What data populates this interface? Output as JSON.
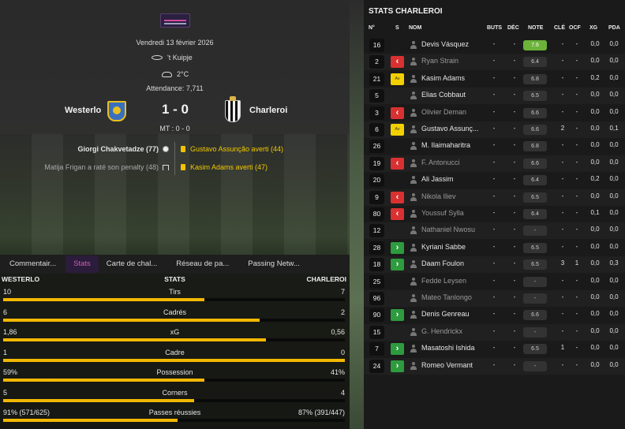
{
  "match": {
    "date": "Vendredi 13 février 2026",
    "venue": "'t Kuipje",
    "weather": "2°C",
    "attendance": "Attendance: 7,711",
    "home": "Westerlo",
    "away": "Charleroi",
    "score": "1 - 0",
    "ht": "MT : 0 - 0"
  },
  "events": {
    "home": [
      {
        "text": "Giorgi Chakvetadze (77)",
        "icon": "ball-icon"
      },
      {
        "text": "Matija Frigan a raté son penalty (48)",
        "icon": "goal-icon"
      }
    ],
    "away": [
      {
        "text": "Gustavo Assunção averti (44)",
        "icon": "yellow-card-icon"
      },
      {
        "text": "Kasim Adams averti (47)",
        "icon": "yellow-card-icon"
      }
    ]
  },
  "tabs": [
    "Commentair...",
    "Stats",
    "Carte de chal...",
    "Réseau de pa...",
    "Passing Netw..."
  ],
  "active_tab": "Stats",
  "stats": {
    "home_label": "WESTERLO",
    "title": "STATS",
    "away_label": "CHARLEROI",
    "rows": [
      {
        "name": "Tirs",
        "home": "10",
        "away": "7",
        "share": 0.59
      },
      {
        "name": "Cadrés",
        "home": "6",
        "away": "2",
        "share": 0.75
      },
      {
        "name": "xG",
        "home": "1,86",
        "away": "0,56",
        "share": 0.77
      },
      {
        "name": "Cadre",
        "home": "1",
        "away": "0",
        "share": 1.0
      },
      {
        "name": "Possession",
        "home": "59%",
        "away": "41%",
        "share": 0.59
      },
      {
        "name": "Corners",
        "home": "5",
        "away": "4",
        "share": 0.56
      },
      {
        "name": "Passes réussies",
        "home": "91% (571/625)",
        "away": "87% (391/447)",
        "share": 0.51
      }
    ]
  },
  "team_stats": {
    "title": "STATS CHARLEROI",
    "headers": [
      "N°",
      "S",
      "NOM",
      "BUTS",
      "DÉC",
      "NOTE",
      "CLÉ",
      "OCF",
      "XG",
      "PDA"
    ],
    "players": [
      {
        "num": "16",
        "status": "",
        "name": "Devis Vásquez",
        "dim": false,
        "buts": "-",
        "dec": "-",
        "note": "7.6",
        "best": true,
        "cle": "-",
        "ocf": "-",
        "xg": "0,0",
        "pda": "0,0"
      },
      {
        "num": "2",
        "status": "off",
        "name": "Ryan Strain",
        "dim": true,
        "buts": "-",
        "dec": "-",
        "note": "6.4",
        "best": false,
        "cle": "-",
        "ocf": "-",
        "xg": "0,0",
        "pda": "0,0"
      },
      {
        "num": "21",
        "status": "yellow",
        "name": "Kasim Adams",
        "dim": false,
        "buts": "-",
        "dec": "-",
        "note": "6.8",
        "best": false,
        "cle": "-",
        "ocf": "-",
        "xg": "0,2",
        "pda": "0,0"
      },
      {
        "num": "5",
        "status": "",
        "name": "Elias Cobbaut",
        "dim": false,
        "buts": "-",
        "dec": "-",
        "note": "6.5",
        "best": false,
        "cle": "-",
        "ocf": "-",
        "xg": "0,0",
        "pda": "0,0"
      },
      {
        "num": "3",
        "status": "off",
        "name": "Olivier Deman",
        "dim": true,
        "buts": "-",
        "dec": "-",
        "note": "6.6",
        "best": false,
        "cle": "-",
        "ocf": "-",
        "xg": "0,0",
        "pda": "0,0"
      },
      {
        "num": "6",
        "status": "yellow",
        "name": "Gustavo Assunç...",
        "dim": false,
        "buts": "-",
        "dec": "-",
        "note": "6.6",
        "best": false,
        "cle": "2",
        "ocf": "-",
        "xg": "0,0",
        "pda": "0,1"
      },
      {
        "num": "26",
        "status": "",
        "name": "M. Ilaimaharitra",
        "dim": false,
        "buts": "-",
        "dec": "-",
        "note": "6.8",
        "best": false,
        "cle": "-",
        "ocf": "-",
        "xg": "0,0",
        "pda": "0,0"
      },
      {
        "num": "19",
        "status": "off",
        "name": "F. Antonucci",
        "dim": true,
        "buts": "-",
        "dec": "-",
        "note": "6.6",
        "best": false,
        "cle": "-",
        "ocf": "-",
        "xg": "0,0",
        "pda": "0,0"
      },
      {
        "num": "20",
        "status": "",
        "name": "Ali Jassim",
        "dim": false,
        "buts": "-",
        "dec": "-",
        "note": "6.4",
        "best": false,
        "cle": "-",
        "ocf": "-",
        "xg": "0,2",
        "pda": "0,0"
      },
      {
        "num": "9",
        "status": "off",
        "name": "Nikola Iliev",
        "dim": true,
        "buts": "-",
        "dec": "-",
        "note": "6.5",
        "best": false,
        "cle": "-",
        "ocf": "-",
        "xg": "0,0",
        "pda": "0,0"
      },
      {
        "num": "80",
        "status": "off",
        "name": "Youssuf Sylla",
        "dim": true,
        "buts": "-",
        "dec": "-",
        "note": "6.4",
        "best": false,
        "cle": "-",
        "ocf": "-",
        "xg": "0,1",
        "pda": "0,0"
      },
      {
        "num": "12",
        "status": "",
        "name": "Nathaniel Nwosu",
        "dim": true,
        "buts": "-",
        "dec": "-",
        "note": "-",
        "best": false,
        "cle": "-",
        "ocf": "-",
        "xg": "0,0",
        "pda": "0,0"
      },
      {
        "num": "28",
        "status": "on",
        "name": "Kyriani Sabbe",
        "dim": false,
        "buts": "-",
        "dec": "-",
        "note": "6.5",
        "best": false,
        "cle": "-",
        "ocf": "-",
        "xg": "0,0",
        "pda": "0,0"
      },
      {
        "num": "18",
        "status": "on",
        "name": "Daam Foulon",
        "dim": false,
        "buts": "-",
        "dec": "-",
        "note": "6.5",
        "best": false,
        "cle": "3",
        "ocf": "1",
        "xg": "0,0",
        "pda": "0,3"
      },
      {
        "num": "25",
        "status": "",
        "name": "Fedde Leysen",
        "dim": true,
        "buts": "-",
        "dec": "-",
        "note": "-",
        "best": false,
        "cle": "-",
        "ocf": "-",
        "xg": "0,0",
        "pda": "0,0"
      },
      {
        "num": "96",
        "status": "",
        "name": "Mateo Tanlongo",
        "dim": true,
        "buts": "-",
        "dec": "-",
        "note": "-",
        "best": false,
        "cle": "-",
        "ocf": "-",
        "xg": "0,0",
        "pda": "0,0"
      },
      {
        "num": "90",
        "status": "on",
        "name": "Denis Genreau",
        "dim": false,
        "buts": "-",
        "dec": "-",
        "note": "6.6",
        "best": false,
        "cle": "-",
        "ocf": "-",
        "xg": "0,0",
        "pda": "0,0"
      },
      {
        "num": "15",
        "status": "",
        "name": "G. Hendrickx",
        "dim": true,
        "buts": "-",
        "dec": "-",
        "note": "-",
        "best": false,
        "cle": "-",
        "ocf": "-",
        "xg": "0,0",
        "pda": "0,0"
      },
      {
        "num": "7",
        "status": "on",
        "name": "Masatoshi Ishida",
        "dim": false,
        "buts": "-",
        "dec": "-",
        "note": "6.5",
        "best": false,
        "cle": "1",
        "ocf": "-",
        "xg": "0,0",
        "pda": "0,0"
      },
      {
        "num": "24",
        "status": "on",
        "name": "Romeo Vermant",
        "dim": false,
        "buts": "-",
        "dec": "-",
        "note": "-",
        "best": false,
        "cle": "-",
        "ocf": "-",
        "xg": "0,0",
        "pda": "0,0"
      }
    ],
    "yellow_label": "Av"
  }
}
